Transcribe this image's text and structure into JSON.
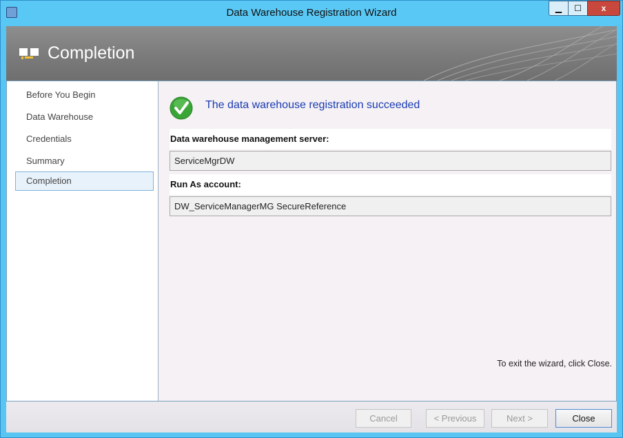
{
  "window": {
    "title": "Data Warehouse Registration Wizard",
    "min_glyph": "▁",
    "max_glyph": "☐",
    "close_glyph": "x"
  },
  "banner": {
    "title": "Completion"
  },
  "nav": {
    "items": [
      {
        "label": "Before You Begin"
      },
      {
        "label": "Data Warehouse"
      },
      {
        "label": "Credentials"
      },
      {
        "label": "Summary"
      },
      {
        "label": "Completion"
      }
    ],
    "selected_index": 4
  },
  "main": {
    "status_text": "The data warehouse registration succeeded",
    "fields": [
      {
        "label": "Data warehouse management server:",
        "value": "ServiceMgrDW"
      },
      {
        "label": "Run As account:",
        "value": "DW_ServiceManagerMG SecureReference"
      }
    ],
    "exit_hint": "To exit the wizard, click Close."
  },
  "footer": {
    "cancel": "Cancel",
    "previous": "< Previous",
    "next": "Next >",
    "close": "Close"
  },
  "colors": {
    "titlebar": "#5ac8f5",
    "banner": "#7b7b7b",
    "success_text": "#1a3bb3",
    "success_icon": "#3aa537",
    "close_button": "#c9483d"
  },
  "icons": {
    "app": "app-icon",
    "banner": "wizard-pages-icon",
    "status": "success-check-icon"
  }
}
